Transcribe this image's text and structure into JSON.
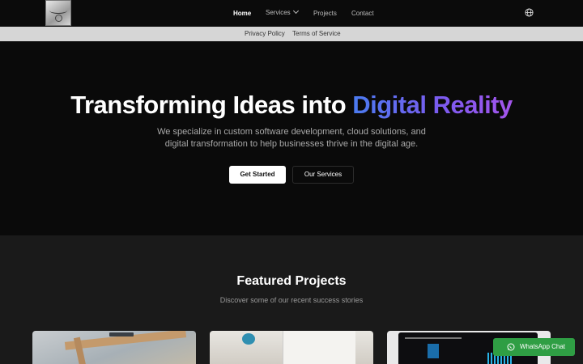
{
  "nav": {
    "items": [
      {
        "label": "Home",
        "active": true
      },
      {
        "label": "Services",
        "has_dropdown": true
      },
      {
        "label": "Projects"
      },
      {
        "label": "Contact"
      }
    ],
    "language_icon": "globe-icon",
    "logo_icon": "company-logo"
  },
  "subnav": {
    "links": [
      {
        "label": "Privacy Policy"
      },
      {
        "label": "Terms of Service"
      }
    ]
  },
  "hero": {
    "title_plain": "Transforming Ideas into ",
    "title_highlight": "Digital Reality",
    "subtitle": "We specialize in custom software development, cloud solutions, and digital transformation to help businesses thrive in the digital age.",
    "primary_button": "Get Started",
    "secondary_button": "Our Services",
    "highlight_gradient": [
      "#4a7bf0",
      "#7b5bef",
      "#a455ec"
    ]
  },
  "featured": {
    "title": "Featured Projects",
    "subtitle": "Discover some of our recent success stories",
    "cards": [
      {
        "image": "workspace-desk-photo"
      },
      {
        "image": "doctor-stethoscope-photo"
      },
      {
        "image": "analytics-dashboard-photo"
      }
    ]
  },
  "whatsapp": {
    "label": "WhatsApp Chat",
    "icon": "whatsapp-icon",
    "color": "#2f9e44"
  }
}
